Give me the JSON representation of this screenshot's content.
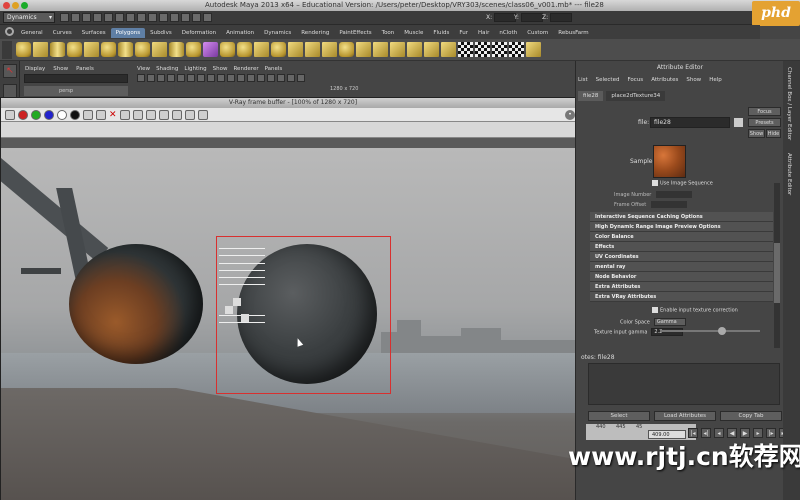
{
  "window": {
    "title": "Autodesk Maya 2013 x64 – Educational Version: /Users/peter/Desktop/VRY303/scenes/class06_v001.mb* --- file28",
    "traffic_colors": [
      "#e0443e",
      "#dea123",
      "#1aab29"
    ]
  },
  "status_line": {
    "mode": "Dynamics",
    "x_label": "X:",
    "y_label": "Y:",
    "z_label": "Z:"
  },
  "logo": {
    "text": "phd",
    "color": "#e4a232"
  },
  "shelf": {
    "tabs": [
      "General",
      "Curves",
      "Surfaces",
      "Polygons",
      "Subdivs",
      "Deformation",
      "Animation",
      "Dynamics",
      "Rendering",
      "PaintEffects",
      "Toon",
      "Muscle",
      "Fluids",
      "Fur",
      "Hair",
      "nCloth",
      "Custom",
      "RebusFarm"
    ],
    "active_tab": "Polygons"
  },
  "outliner": {
    "menu": [
      "Display",
      "Show",
      "Panels"
    ],
    "row_text": "persp"
  },
  "viewport": {
    "menu": [
      "View",
      "Shading",
      "Lighting",
      "Show",
      "Renderer",
      "Panels"
    ],
    "resolution": "1280 x 720"
  },
  "vfb": {
    "title": "V-Ray frame buffer - [100% of 1280 x 720]",
    "region_color": "#d8302f"
  },
  "attribute_editor": {
    "title": "Attribute Editor",
    "menu": [
      "List",
      "Selected",
      "Focus",
      "Attributes",
      "Show",
      "Help"
    ],
    "tabs": [
      "file28",
      "place2dTexture34"
    ],
    "focus_btn": "Focus",
    "presets_btn": "Presets",
    "show_btn": "Show",
    "hide_btn": "Hide",
    "file_label": "file:",
    "file_value": "file28",
    "sample_label": "Sample",
    "use_image_sequence": "Use Image Sequence",
    "image_number": "Image Number",
    "frame_offset": "Frame Offset",
    "sections": [
      "Interactive Sequence Caching Options",
      "High Dynamic Range Image Preview Options",
      "Color Balance",
      "Effects",
      "UV Coordinates",
      "mental ray",
      "Node Behavior",
      "Extra Attributes",
      "Extra VRay Attributes"
    ],
    "enable_texture_correction": "Enable input texture correction",
    "color_space_label": "Color Space",
    "color_space_value": "Gamma",
    "texture_gamma_label": "Texture input gamma",
    "texture_gamma_value": "2.2",
    "texture_gamma_fraction": 0.58,
    "notes_label": "otes: file28",
    "buttons": [
      "Select",
      "Load Attributes",
      "Copy Tab"
    ]
  },
  "timeline": {
    "ticks": [
      "440",
      "445",
      "45"
    ],
    "current_time": "409.00"
  },
  "side_tabs": [
    "Channel Box / Layer Editor",
    "Attribute Editor"
  ],
  "watermark": "www.rjtj.cn软荐网"
}
